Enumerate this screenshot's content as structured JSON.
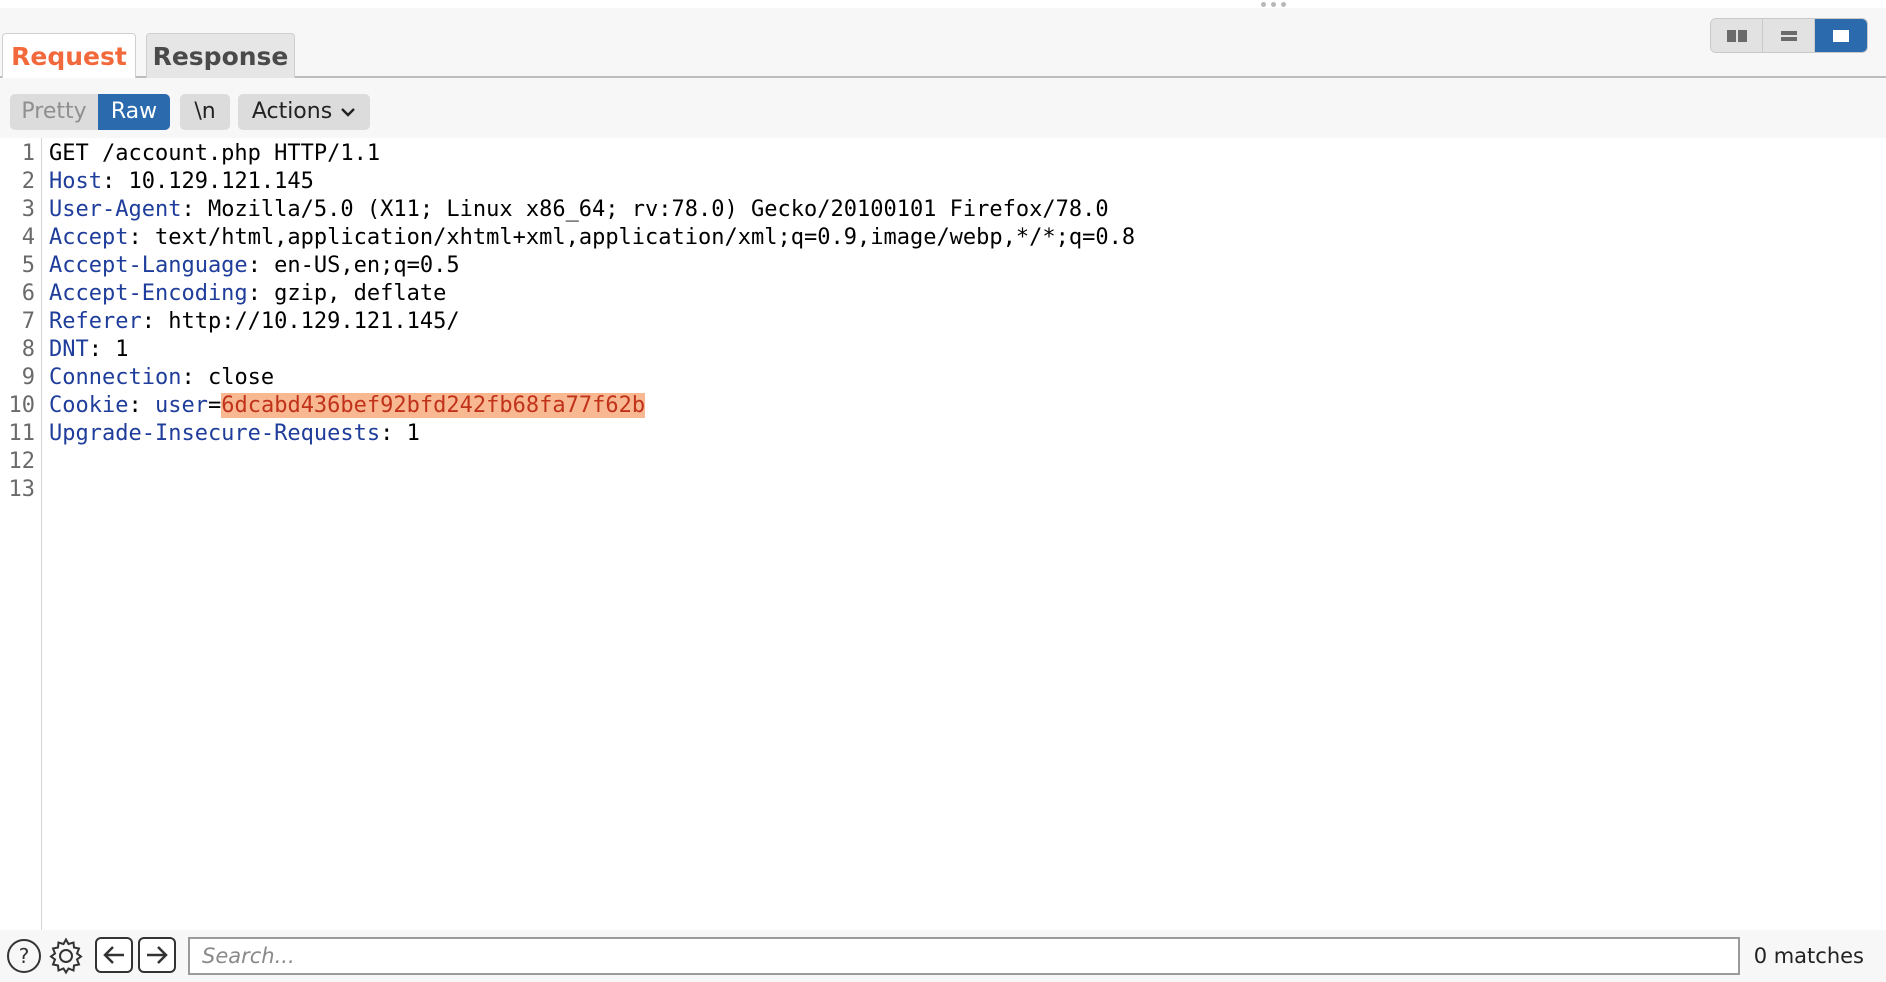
{
  "tabs": {
    "request_label": "Request",
    "response_label": "Response"
  },
  "layout_toggle": {
    "options": [
      "split-horizontal",
      "split-vertical",
      "single"
    ],
    "active": "single"
  },
  "toolbar": {
    "pretty_label": "Pretty",
    "raw_label": "Raw",
    "newline_label": "\\n",
    "actions_label": "Actions"
  },
  "editor": {
    "lines": [
      {
        "no": "1",
        "text": "GET /account.php HTTP/1.1"
      },
      {
        "no": "2",
        "name": "Host",
        "value": " 10.129.121.145"
      },
      {
        "no": "3",
        "name": "User-Agent",
        "value": " Mozilla/5.0 (X11; Linux x86_64; rv:78.0) Gecko/20100101 Firefox/78.0"
      },
      {
        "no": "4",
        "name": "Accept",
        "value": " text/html,application/xhtml+xml,application/xml;q=0.9,image/webp,*/*;q=0.8"
      },
      {
        "no": "5",
        "name": "Accept-Language",
        "value": " en-US,en;q=0.5"
      },
      {
        "no": "6",
        "name": "Accept-Encoding",
        "value": " gzip, deflate"
      },
      {
        "no": "7",
        "name": "Referer",
        "value": " http://10.129.121.145/"
      },
      {
        "no": "8",
        "name": "DNT",
        "value": " 1"
      },
      {
        "no": "9",
        "name": "Connection",
        "value": " close"
      },
      {
        "no": "10",
        "name": "Cookie",
        "cookie_name": "user",
        "cookie_value": "6dcabd436bef92bfd242fb68fa77f62b"
      },
      {
        "no": "11",
        "name": "Upgrade-Insecure-Requests",
        "value": " 1"
      },
      {
        "no": "12",
        "text": ""
      },
      {
        "no": "13",
        "text": ""
      }
    ]
  },
  "footer": {
    "search_placeholder": "Search...",
    "matches_label": "0 matches"
  },
  "colors": {
    "accent": "#f26a3c",
    "primary": "#2a6aad",
    "header_name": "#1f3d9a",
    "cookie_value_text": "#c1321b",
    "cookie_value_bg": "#f8b891"
  }
}
